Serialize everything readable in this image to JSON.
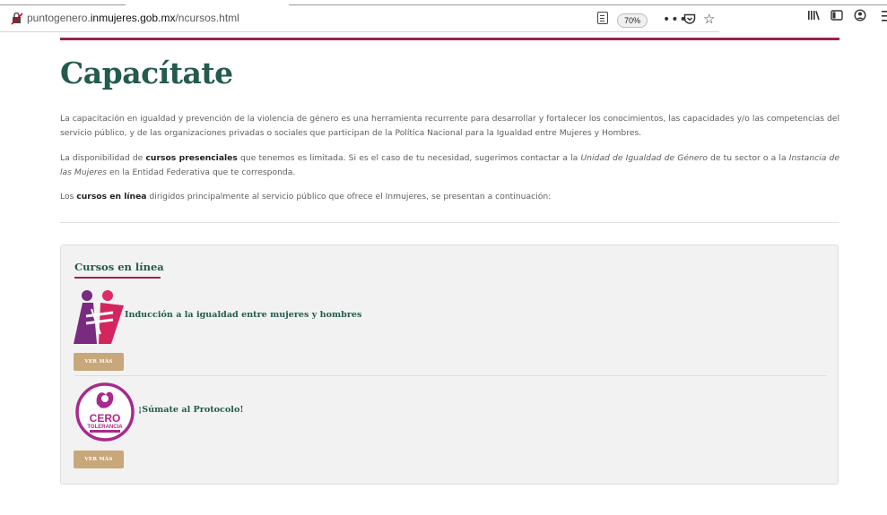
{
  "browser": {
    "url_prefix": "puntogenero.",
    "url_domain": "inmujeres.gob.mx",
    "url_path": "/ncursos.html",
    "zoom_level": "70%",
    "more_label": "•••"
  },
  "page": {
    "title": "Capacítate",
    "p1": "La capacitación en igualdad y prevención de la violencia de género es una herramienta recurrente para desarrollar y fortalecer los conocimientos, las capacidades y/o las competencias del servicio público, y de las organizaciones privadas o sociales que participan de la Política Nacional para la Igualdad entre Mujeres y Hombres.",
    "p2": {
      "a": "La disponibilidad de ",
      "b": "cursos presenciales",
      "c": " que tenemos es limitada. Si es el caso de tu necesidad, sugerimos contactar a la ",
      "d": "Unidad de Igualdad de Género",
      "e": " de tu sector o a la ",
      "f": "Instancia de las Mujeres",
      "g": " en la Entidad Federativa que te corresponda."
    },
    "p3": {
      "a": "Los ",
      "b": "cursos en línea",
      "c": " dirigidos principalmente al servicio público que ofrece el Inmujeres, se presentan a continuación:"
    }
  },
  "online_courses": {
    "heading": "Cursos en línea",
    "courses": [
      {
        "title": "Inducción a la igualdad entre mujeres y hombres",
        "button": "VER MÁS"
      },
      {
        "title": "¡Súmate al Protocolo!",
        "button": "VER MÁS",
        "logo_text_1": "CERO",
        "logo_text_2": "TOLERANCIA"
      }
    ]
  },
  "colors": {
    "accent_wine": "#9b2247",
    "accent_green": "#235b4e",
    "button_gold": "#c8a87a"
  }
}
